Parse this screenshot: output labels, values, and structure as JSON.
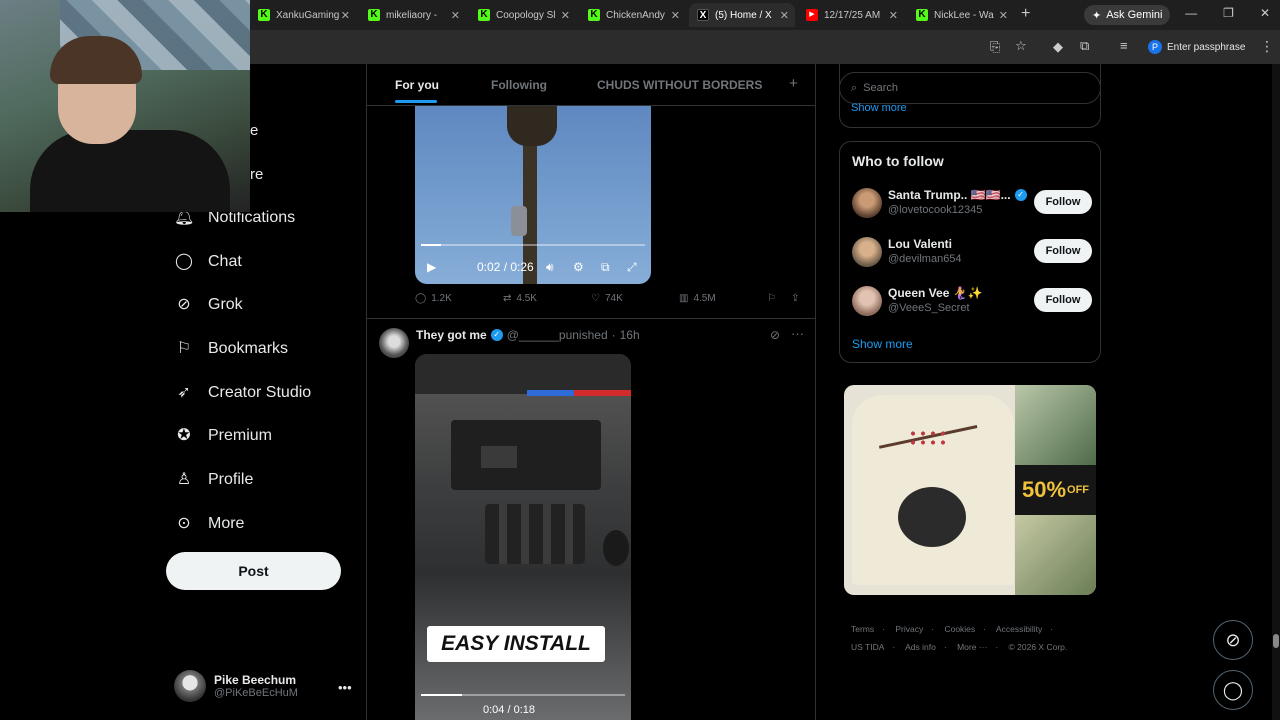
{
  "browser": {
    "tabs": [
      {
        "title": "XankuGaming",
        "favicon": "kick-icon"
      },
      {
        "title": "mikeliaory - ",
        "favicon": "kick-icon"
      },
      {
        "title": "Coopology Sl",
        "favicon": "kick-icon"
      },
      {
        "title": "ChickenAndy",
        "favicon": "kick-icon"
      },
      {
        "title": "(5) Home / X",
        "favicon": "x-icon",
        "active": true
      },
      {
        "title": "12/17/25 AM",
        "favicon": "youtube-icon"
      },
      {
        "title": "NickLee - Wa",
        "favicon": "kick-icon"
      }
    ],
    "ask_gemini": "Ask Gemini",
    "passphrase_label": "Enter passphrase",
    "profile_initial": "P"
  },
  "nav": {
    "partial_1": "e",
    "partial_2": "re",
    "items": [
      {
        "label": "Notifications",
        "icon": "bell-icon"
      },
      {
        "label": "Chat",
        "icon": "chat-icon"
      },
      {
        "label": "Grok",
        "icon": "grok-icon"
      },
      {
        "label": "Bookmarks",
        "icon": "bookmark-icon"
      },
      {
        "label": "Creator Studio",
        "icon": "rocket-icon"
      },
      {
        "label": "Premium",
        "icon": "premium-icon"
      },
      {
        "label": "Profile",
        "icon": "person-icon"
      },
      {
        "label": "More",
        "icon": "more-circle-icon"
      }
    ],
    "post_label": "Post",
    "user": {
      "name": "Pike Beechum",
      "handle": "@PiKeBeEcHuM"
    }
  },
  "feed": {
    "tabs": [
      "For you",
      "Following",
      "CHUDS WITHOUT BORDERS"
    ],
    "active_tab": "For you",
    "post1": {
      "video_time": "0:02 / 0:26",
      "progress": 0.09,
      "stats": {
        "replies": "1.2K",
        "reposts": "4.5K",
        "likes": "74K",
        "views": "4.5M"
      }
    },
    "post2": {
      "author": "They got me",
      "handle": "@______punished",
      "time": "16h",
      "video_caption": "EASY INSTALL",
      "video_time": "0:04 / 0:18",
      "progress": 0.2
    }
  },
  "sidebar": {
    "search_placeholder": "Search",
    "show_more_top": "Show more",
    "who_to_follow_title": "Who to follow",
    "suggestions": [
      {
        "name": "Santa Trump.. 🇺🇸🇺🇸...",
        "handle": "@lovetocook12345",
        "verified": true,
        "follow": "Follow"
      },
      {
        "name": "Lou Valenti",
        "handle": "@devilman654",
        "verified": false,
        "follow": "Follow"
      },
      {
        "name": "Queen Vee 🧜‍♀️✨",
        "handle": "@VeeeS_Secret",
        "verified": false,
        "follow": "Follow"
      }
    ],
    "show_more": "Show more",
    "ad": {
      "discount": "50%",
      "discount_suffix": "OFF"
    },
    "footer": [
      "Terms",
      "Privacy",
      "Cookies",
      "Accessibility",
      "US TIDA",
      "Ads info",
      "More ···",
      "© 2026 X Corp."
    ]
  },
  "colors": {
    "accent": "#1d9bf0",
    "background": "#000000",
    "border": "#2f3336",
    "muted_text": "#71767b"
  }
}
